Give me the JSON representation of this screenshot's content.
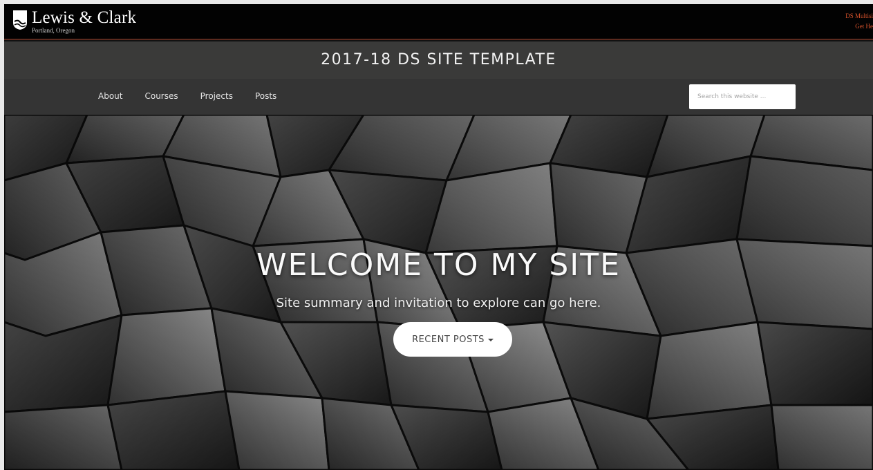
{
  "header": {
    "logo_name": "Lewis & Clark",
    "logo_location": "Portland, Oregon",
    "top_links": [
      "DS Multisi",
      "Get He"
    ]
  },
  "site": {
    "title": "2017-18 DS SITE TEMPLATE"
  },
  "nav": {
    "items": [
      {
        "label": "About"
      },
      {
        "label": "Courses"
      },
      {
        "label": "Projects"
      },
      {
        "label": "Posts"
      }
    ],
    "search_placeholder": "Search this website ..."
  },
  "hero": {
    "title": "WELCOME TO MY SITE",
    "subtitle": "Site summary and invitation to explore can go here.",
    "button_label": "RECENT POSTS"
  },
  "colors": {
    "topbar_bg": "#020202",
    "title_bar_bg": "#3a3a39",
    "nav_bg": "#343434",
    "top_link_color": "#d9532c",
    "accent_border": "#5b2a1e"
  },
  "icons": {
    "logo": "lewis-clark-shield-icon",
    "dropdown": "caret-down-icon"
  }
}
